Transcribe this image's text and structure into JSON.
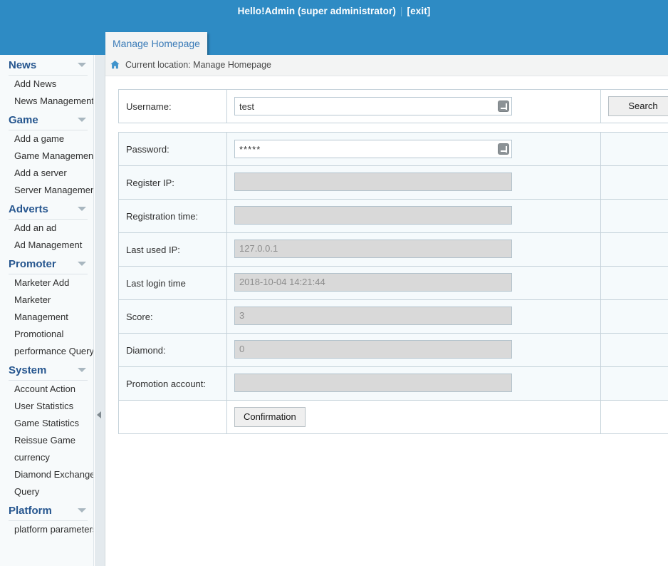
{
  "topbar": {
    "greeting": "Hello!Admin (super administrator)",
    "separator": "|",
    "exit_label": "[exit]",
    "background_color": "#2e8bc4"
  },
  "tab": {
    "label": "Manage Homepage"
  },
  "breadcrumb": {
    "home_icon": "home-icon",
    "text": "Current location: Manage Homepage"
  },
  "sidebar": {
    "sections": [
      {
        "title": "News",
        "caret": "chevron-down-icon",
        "items": [
          "Add News",
          "News Management"
        ]
      },
      {
        "title": "Game",
        "caret": "chevron-down-icon",
        "items": [
          "Add a game",
          "Game Management",
          "Add a server",
          "Server Management"
        ]
      },
      {
        "title": "Adverts",
        "caret": "chevron-down-icon",
        "items": [
          "Add an ad",
          "Ad Management"
        ]
      },
      {
        "title": "Promoter",
        "caret": "chevron-down-icon",
        "items": [
          "Marketer Add",
          "Marketer",
          "Management",
          "Promotional",
          "performance Query"
        ]
      },
      {
        "title": "System",
        "caret": "chevron-down-icon",
        "items": [
          "Account Action",
          "User Statistics",
          "Game Statistics",
          "Reissue Game",
          "currency",
          "Diamond Exchange",
          "Query"
        ]
      },
      {
        "title": "Platform",
        "caret": "chevron-down-icon",
        "items": [
          "platform parameters"
        ]
      }
    ],
    "collapse_handle": "collapse-left-arrow-icon"
  },
  "search_form": {
    "username_label": "Username:",
    "username_value": "test",
    "username_placeholder": "",
    "search_button": "Search"
  },
  "detail_form": {
    "rows": [
      {
        "label": "Password:",
        "value": "*****",
        "disabled": false
      },
      {
        "label": "Register IP:",
        "value": "",
        "disabled": true
      },
      {
        "label": "Registration time:",
        "value": "",
        "disabled": true
      },
      {
        "label": "Last used IP:",
        "value": "127.0.0.1",
        "disabled": true
      },
      {
        "label": "Last login time",
        "value": "2018-10-04 14:21:44",
        "disabled": true
      },
      {
        "label": "Score:",
        "value": "3",
        "disabled": true
      },
      {
        "label": "Diamond:",
        "value": "0",
        "disabled": true
      },
      {
        "label": "Promotion account:",
        "value": "",
        "disabled": true
      }
    ],
    "confirm_button": "Confirmation"
  },
  "colors": {
    "header_blue": "#2e8bc4",
    "tab_text": "#3c7cb8",
    "section_title": "#26568f",
    "row_tint": "#f5fafc",
    "disabled_field": "#d9d9d9"
  }
}
